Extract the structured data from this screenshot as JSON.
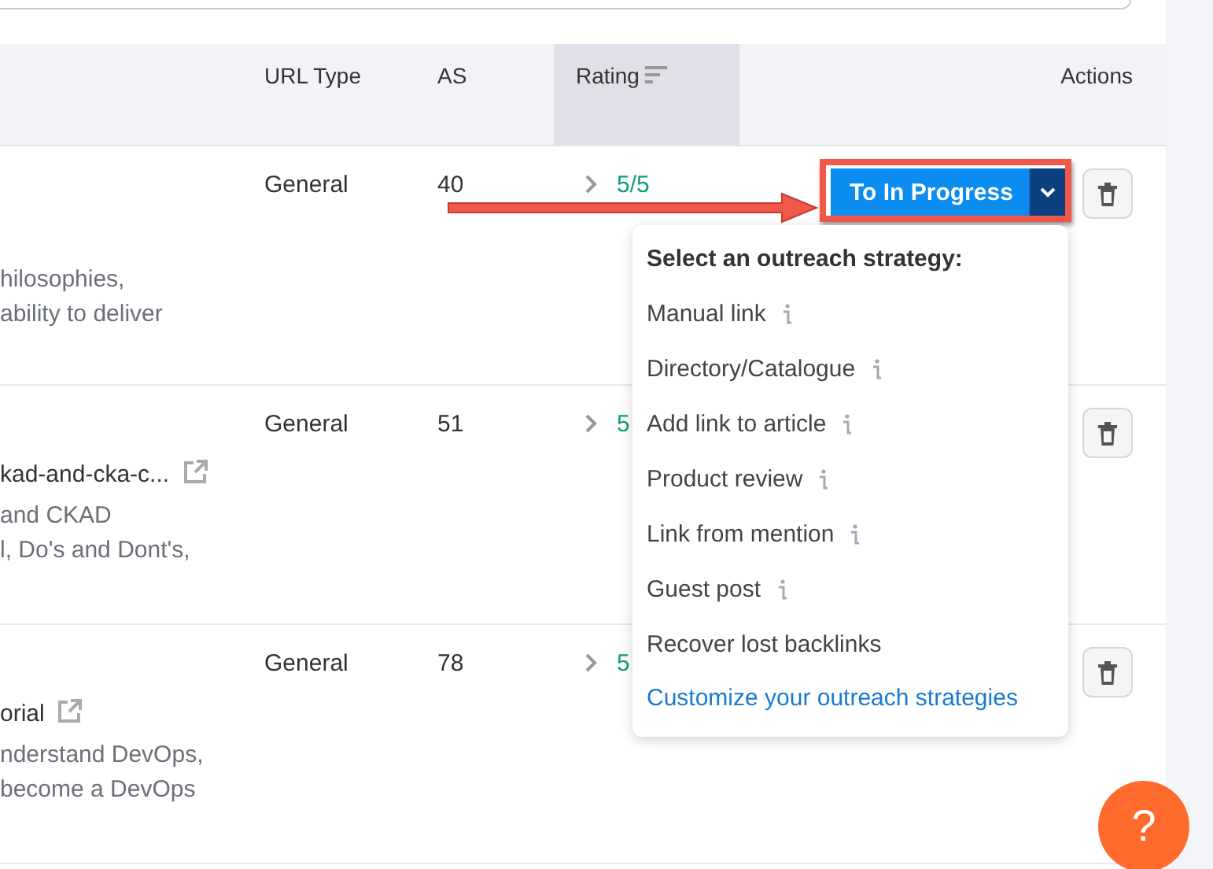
{
  "header": {
    "columns": [
      {
        "label": "URL Type",
        "sorted": false
      },
      {
        "label": "AS",
        "sorted": false
      },
      {
        "label": "Rating",
        "sorted": true
      },
      {
        "label": "Actions",
        "sorted": false
      }
    ]
  },
  "rows": [
    {
      "description": [
        "hilosophies,",
        "ability to deliver"
      ],
      "url_type": "General",
      "as": "40",
      "rating": "5/5"
    },
    {
      "title": "kad-and-cka-c...",
      "description": [
        "and CKAD",
        "l, Do's and Dont's,"
      ],
      "url_type": "General",
      "as": "51",
      "rating": "5"
    },
    {
      "title": "orial",
      "description": [
        "nderstand DevOps,",
        "become a DevOps"
      ],
      "url_type": "General",
      "as": "78",
      "rating": "5"
    }
  ],
  "action_button": {
    "label": "To In Progress"
  },
  "strategy_menu": {
    "heading": "Select an outreach strategy:",
    "items": [
      {
        "label": "Manual link",
        "info": true
      },
      {
        "label": "Directory/Catalogue",
        "info": true
      },
      {
        "label": "Add link to article",
        "info": true
      },
      {
        "label": "Product review",
        "info": true
      },
      {
        "label": "Link from mention",
        "info": true
      },
      {
        "label": "Guest post",
        "info": true
      },
      {
        "label": "Recover lost backlinks",
        "info": false
      }
    ],
    "link": "Customize your outreach strategies"
  },
  "help_button": {
    "label": "?"
  }
}
